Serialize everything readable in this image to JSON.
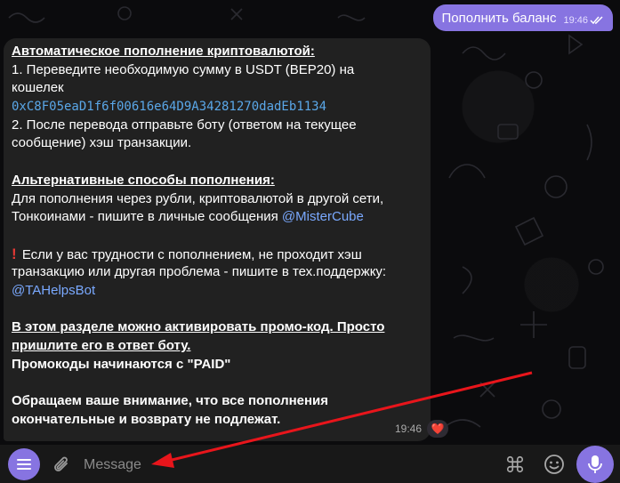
{
  "outgoing": {
    "text": "Пополнить баланс",
    "time": "19:46"
  },
  "incoming": {
    "heading1": "Автоматическое пополнение криптовалютой:",
    "step1_a": "1. Переведите необходимую сумму в USDT (BEP20) на",
    "step1_b": "кошелек",
    "wallet": "0xC8F05eaD1f6f00616e64D9A34281270dadEb1134",
    "step2_a": "2. После перевода отправьте боту (ответом на текущее",
    "step2_b": "сообщение) хэш транзакции.",
    "heading2": "Альтернативные способы пополнения:",
    "alt_a": "Для пополнения через рубли, криптовалютой в другой сети,",
    "alt_b": "Тонкоинами - пишите в личные сообщения ",
    "alt_link": "@MisterCube",
    "trouble_a": "Если у вас трудности с пополнением, не проходит хэш",
    "trouble_b": "транзакцию или другая проблема - пишите в тех.поддержку:",
    "support_link": "@TAHelpsBot",
    "promo_a": "В этом разделе можно активировать промо-код. Просто",
    "promo_b": "пришлите его в ответ боту.",
    "promo_c": "Промокоды начинаются с \"PAID\"",
    "notice_a": "Обращаем ваше внимание, что все пополнения",
    "notice_b": "окончательные и возврату не подлежат.",
    "exclaim": "!",
    "time": "19:46",
    "reaction": "❤️"
  },
  "composer": {
    "placeholder": "Message"
  },
  "colors": {
    "accent": "#8774e1",
    "annotation_arrow": "#e8151b"
  }
}
